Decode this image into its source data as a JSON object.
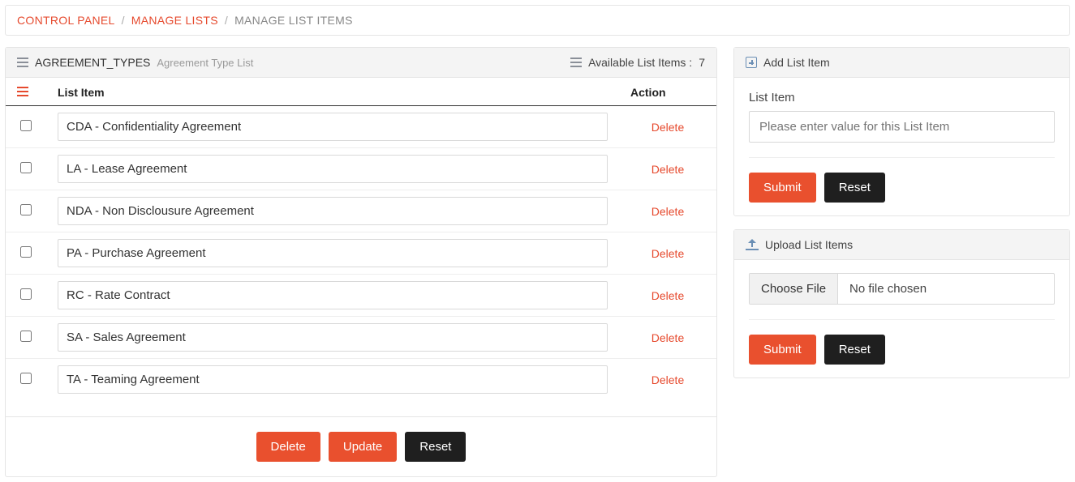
{
  "breadcrumb": {
    "items": [
      {
        "label": "CONTROL PANEL",
        "link": true
      },
      {
        "label": "MANAGE LISTS",
        "link": true
      },
      {
        "label": "MANAGE LIST ITEMS",
        "link": false
      }
    ]
  },
  "listPanel": {
    "listName": "AGREEMENT_TYPES",
    "listDesc": "Agreement Type List",
    "availableLabel": "Available List Items :",
    "availableCount": "7",
    "columns": {
      "item": "List Item",
      "action": "Action"
    },
    "deleteLabel": "Delete",
    "rows": [
      {
        "value": "CDA - Confidentiality Agreement"
      },
      {
        "value": "LA - Lease Agreement"
      },
      {
        "value": "NDA - Non Disclousure Agreement"
      },
      {
        "value": "PA - Purchase Agreement"
      },
      {
        "value": "RC - Rate Contract"
      },
      {
        "value": "SA - Sales Agreement"
      },
      {
        "value": "TA - Teaming Agreement"
      }
    ],
    "footer": {
      "delete": "Delete",
      "update": "Update",
      "reset": "Reset"
    }
  },
  "addPanel": {
    "title": "Add List Item",
    "fieldLabel": "List Item",
    "placeholder": "Please enter value for this List Item",
    "submit": "Submit",
    "reset": "Reset"
  },
  "uploadPanel": {
    "title": "Upload List Items",
    "chooseFile": "Choose File",
    "noFile": "No file chosen",
    "submit": "Submit",
    "reset": "Reset"
  }
}
